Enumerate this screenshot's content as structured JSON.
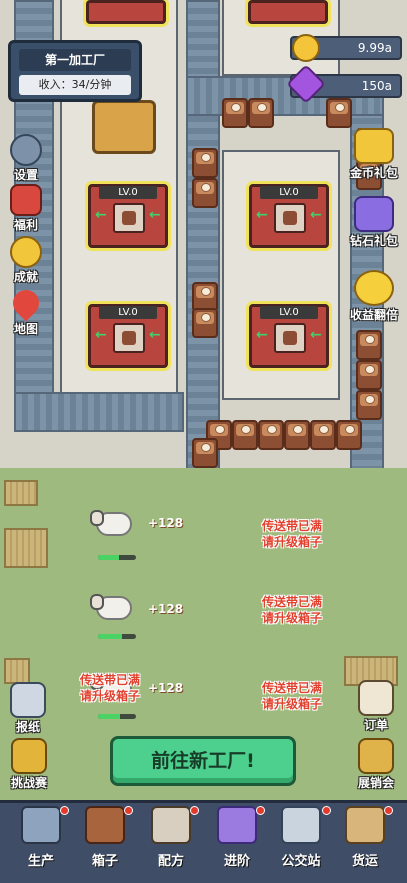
{
  "factory": {
    "name": "第一加工厂",
    "income": "收入：34/分钟"
  },
  "currency": {
    "gold": "9.99a",
    "gems": "150a"
  },
  "side_left": [
    {
      "label": "设置",
      "icon": "gear-icon"
    },
    {
      "label": "福利",
      "icon": "gift-icon"
    },
    {
      "label": "成就",
      "icon": "star-medal-icon"
    },
    {
      "label": "地图",
      "icon": "map-pin-icon"
    }
  ],
  "side_right": [
    {
      "label": "金币礼包",
      "icon": "gold-coins-icon"
    },
    {
      "label": "钻石礼包",
      "icon": "diamond-icon"
    },
    {
      "label": "收益翻倍",
      "icon": "coin-stack-icon"
    }
  ],
  "machines": [
    {
      "level": "LV.0"
    },
    {
      "level": "LV.0"
    },
    {
      "level": "LV.0"
    },
    {
      "level": "LV.0"
    }
  ],
  "pastures": [
    {
      "gain": "+128",
      "progress": 0.55,
      "warn1": "传送带已满",
      "warn2": "请升级箱子"
    },
    {
      "gain": "+128",
      "progress": 0.62,
      "warn1": "传送带已满",
      "warn2": "请升级箱子"
    },
    {
      "gain": "+128",
      "progress": 0.58,
      "warn1": "传送带已满",
      "warn2": "请升级箱子"
    }
  ],
  "left_bottom": [
    {
      "label": "报纸",
      "icon": "newspaper-icon"
    },
    {
      "label": "挑战赛",
      "icon": "trophy-icon"
    }
  ],
  "right_bottom": [
    {
      "label": "订单",
      "icon": "order-list-icon"
    },
    {
      "label": "展销会",
      "icon": "exhibition-icon"
    }
  ],
  "go_button": "前往新工厂!",
  "tabs": [
    {
      "label": "生产",
      "icon": "robot-arm-icon"
    },
    {
      "label": "箱子",
      "icon": "box-icon"
    },
    {
      "label": "配方",
      "icon": "recipe-book-icon"
    },
    {
      "label": "进阶",
      "icon": "upgrade-crystal-icon"
    },
    {
      "label": "公交站",
      "icon": "bus-stop-icon"
    },
    {
      "label": "货运",
      "icon": "cargo-icon"
    }
  ]
}
